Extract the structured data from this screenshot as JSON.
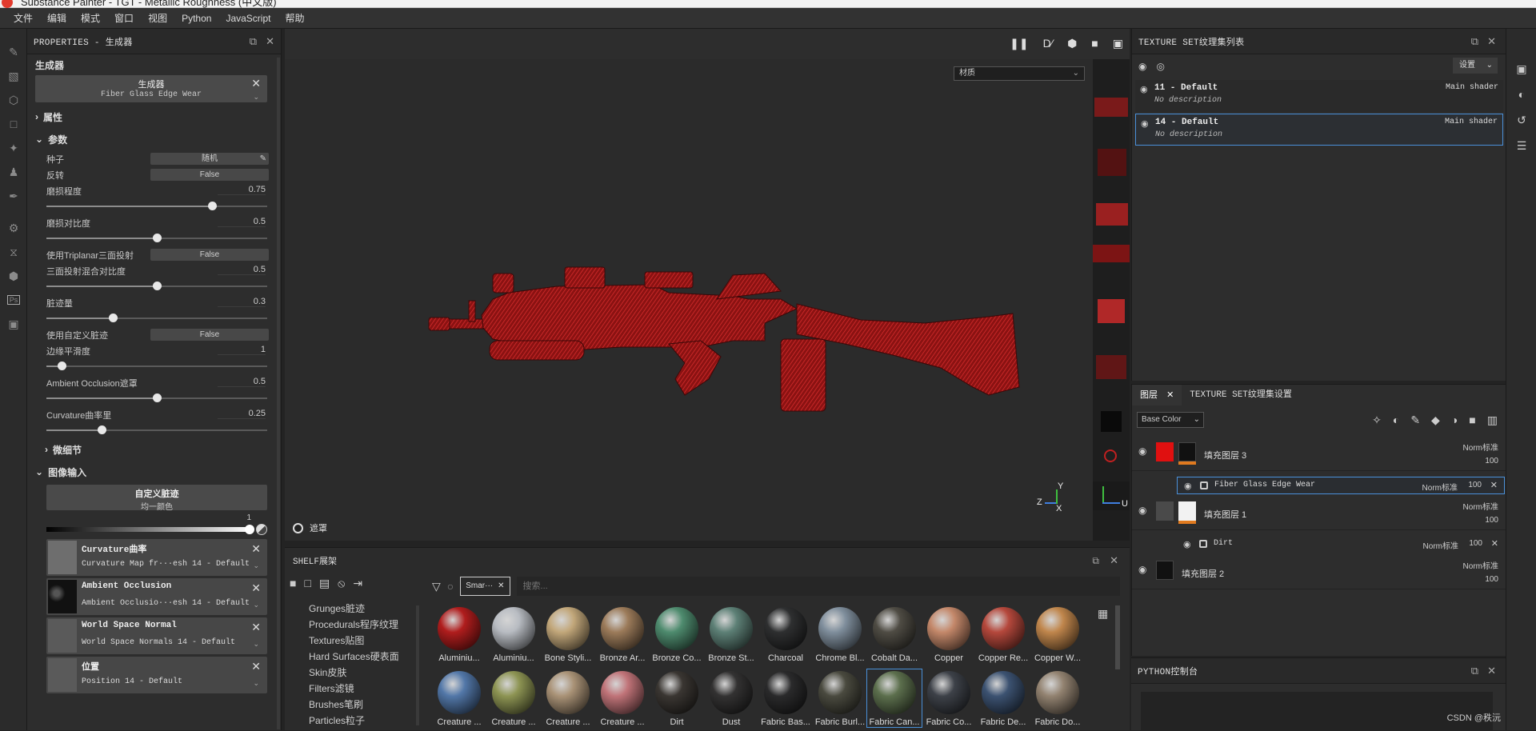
{
  "window": {
    "title_fragment": "Substance Painter - TGT - Metallic Roughness (中文版)"
  },
  "menu": [
    "文件",
    "编辑",
    "模式",
    "窗口",
    "视图",
    "Python",
    "JavaScript",
    "帮助"
  ],
  "properties": {
    "header": "PROPERTIES - 生成器",
    "section_title": "生成器",
    "generator_label": "生成器",
    "generator_value": "Fiber Glass Edge Wear",
    "attributes": "属性",
    "params": "参数",
    "seed_label": "种子",
    "seed_value": "随机",
    "invert_label": "反转",
    "invert_value": "False",
    "wear_level_label": "磨损程度",
    "wear_level_value": "0.75",
    "wear_contrast_label": "磨损对比度",
    "wear_contrast_value": "0.5",
    "triplanar_label": "使用Triplanar三面投射",
    "triplanar_value": "False",
    "tri_blend_label": "三面投射混合对比度",
    "tri_blend_value": "0.5",
    "dirt_label": "脏迹量",
    "dirt_value": "0.3",
    "custom_dirt_label": "使用自定义脏迹",
    "custom_dirt_value": "False",
    "edge_smooth_label": "边缘平滑度",
    "edge_smooth_value": "1",
    "ao_label": "Ambient Occlusion遮罩",
    "ao_value": "0.5",
    "curv_label": "Curvature曲率里",
    "curv_value": "0.25",
    "micro_details": "微细节",
    "image_input": "图像输入",
    "custom_dirt_box_title": "自定义脏迹",
    "custom_dirt_box_sub": "均一颜色",
    "gradient_value": "1",
    "inputs": [
      {
        "title": "Curvature曲率",
        "sub": "Curvature Map fr···esh 14 - Default"
      },
      {
        "title": "Ambient Occlusion",
        "sub": "Ambient Occlusio···esh 14 - Default"
      },
      {
        "title": "World Space Normal",
        "sub": "World Space Normals 14 - Default"
      },
      {
        "title": "位置",
        "sub": "Position 14 - Default"
      }
    ]
  },
  "viewport": {
    "material_dropdown": "材质",
    "mask_label": "遮罩",
    "axis": {
      "y": "Y",
      "z": "Z",
      "x": "X",
      "u": "U"
    }
  },
  "shelf": {
    "title": "SHELF展架",
    "categories": [
      "Grunges脏迹",
      "Procedurals程序纹理",
      "Textures贴图",
      "Hard Surfaces硬表面",
      "Skin皮肤",
      "Filters滤镜",
      "Brushes笔刷",
      "Particles粒子"
    ],
    "filter_tag": "Smar···",
    "search_placeholder": "搜索...",
    "materials": [
      {
        "name": "Aluminiu...",
        "color": "#b01d1d"
      },
      {
        "name": "Aluminiu...",
        "color": "#b8bcc2"
      },
      {
        "name": "Bone Styli...",
        "color": "#c2a77a"
      },
      {
        "name": "Bronze Ar...",
        "color": "#9c7b5a"
      },
      {
        "name": "Bronze Co...",
        "color": "#4e8b6e"
      },
      {
        "name": "Bronze St...",
        "color": "#5d8076"
      },
      {
        "name": "Charcoal",
        "color": "#2e2f30"
      },
      {
        "name": "Chrome Bl...",
        "color": "#7f8e9c"
      },
      {
        "name": "Cobalt Da...",
        "color": "#4f4c44"
      },
      {
        "name": "Copper",
        "color": "#c4886a"
      },
      {
        "name": "Copper Re...",
        "color": "#b5483c"
      },
      {
        "name": "Copper W...",
        "color": "#c0864c"
      },
      {
        "name": "Creature ...",
        "color": "#5277a8"
      },
      {
        "name": "Creature ...",
        "color": "#8d9453"
      },
      {
        "name": "Creature ...",
        "color": "#a99276"
      },
      {
        "name": "Creature ...",
        "color": "#c07378"
      },
      {
        "name": "Dirt",
        "color": "#3a3632"
      },
      {
        "name": "Dust",
        "color": "#333232"
      },
      {
        "name": "Fabric Bas...",
        "color": "#2a2a2b"
      },
      {
        "name": "Fabric Burl...",
        "color": "#4a4a3f"
      },
      {
        "name": "Fabric Can...",
        "color": "#5c6f4d"
      },
      {
        "name": "Fabric Co...",
        "color": "#3d4148"
      },
      {
        "name": "Fabric De...",
        "color": "#3c5271"
      },
      {
        "name": "Fabric Do...",
        "color": "#928270"
      }
    ]
  },
  "texture_sets": {
    "title": "TEXTURE SET纹理集列表",
    "settings_label": "设置",
    "items": [
      {
        "name": "11 - Default",
        "desc": "No description",
        "shader": "Main shader"
      },
      {
        "name": "14 - Default",
        "desc": "No description",
        "shader": "Main shader"
      }
    ]
  },
  "layers": {
    "tab_layers": "图层",
    "tab_ts_settings": "TEXTURE SET纹理集设置",
    "channel": "Base Color",
    "rows": [
      {
        "name": "填充图层 3",
        "blend": "Norm标准",
        "opacity": "100",
        "swatch": "#e01010",
        "mask": "#111"
      },
      {
        "name": "填充图层 1",
        "blend": "Norm标准",
        "opacity": "100",
        "swatch": "#555",
        "mask": "#f2f2f2"
      },
      {
        "name": "填充图层 2",
        "blend": "Norm标准",
        "opacity": "100",
        "swatch": "#111",
        "mask": ""
      }
    ],
    "subs": [
      {
        "name": "Fiber Glass Edge Wear",
        "blend": "Norm标准",
        "opacity": "100"
      },
      {
        "name": "Dirt",
        "blend": "Norm标准",
        "opacity": "100"
      }
    ]
  },
  "python": {
    "title": "PYTHON控制台"
  },
  "watermark": "CSDN @秩沅"
}
